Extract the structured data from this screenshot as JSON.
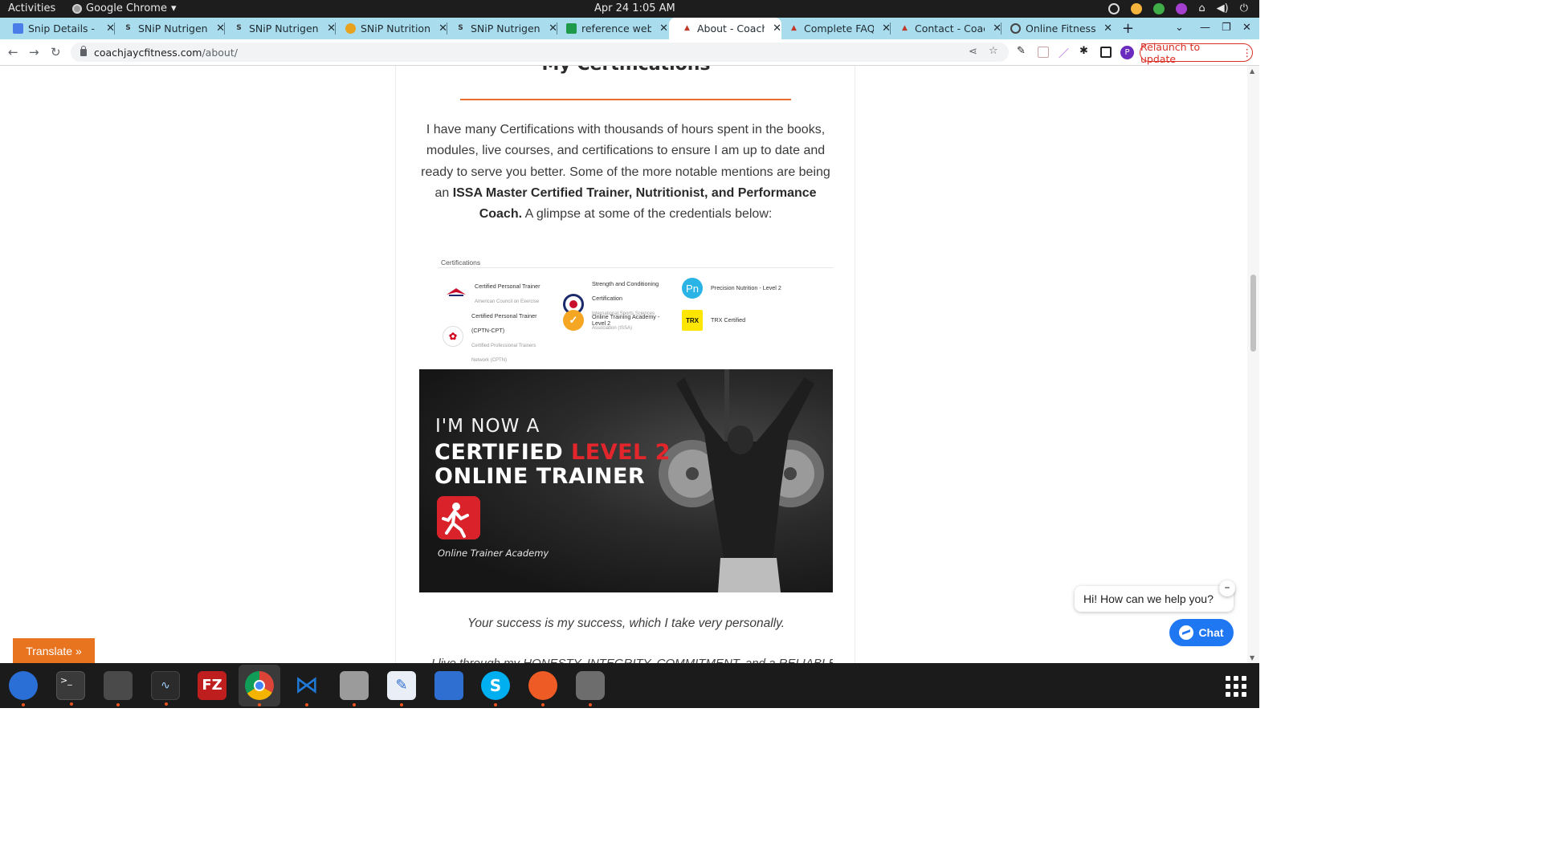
{
  "system_bar": {
    "activities": "Activities",
    "app_name": "Google Chrome",
    "clock": "Apr 24  1:05 AM"
  },
  "tabs": [
    {
      "title": "Snip Details - Google Docs",
      "icon": "docs-icon"
    },
    {
      "title": "SNiP Nutrigenomics",
      "icon": "snip-icon"
    },
    {
      "title": "SNiP Nutrigenomics",
      "icon": "snip-icon"
    },
    {
      "title": "SNiP Nutrition",
      "icon": "snip-nutrition-icon"
    },
    {
      "title": "SNiP Nutrigenomics",
      "icon": "snip-icon"
    },
    {
      "title": "reference websites",
      "icon": "sheets-icon"
    },
    {
      "title": "About - Coach Jay C Fitness",
      "icon": "coach-icon",
      "active": true
    },
    {
      "title": "Complete FAQs",
      "icon": "coach-icon"
    },
    {
      "title": "Contact - Coach Jay",
      "icon": "coach-icon"
    },
    {
      "title": "Online Fitness",
      "icon": "globe-icon"
    }
  ],
  "address_bar": {
    "domain": "coachjaycfitness.com",
    "path": "/about/",
    "relaunch_label": "Relaunch to update",
    "avatar_letter": "P"
  },
  "page": {
    "partial_heading": "My Certifications",
    "paragraph_pre": "I have many Certifications with thousands of hours spent in the books, modules, live courses, and certifications to ensure I am up to date and ready to serve you better. Some of the more notable mentions are being an ",
    "paragraph_bold": "ISSA Master Certified Trainer, Nutritionist, and Performance Coach.",
    "paragraph_post": " A glimpse at some of the credentials below:",
    "cert_heading": "Certifications",
    "certs": [
      {
        "name": "Certified Personal Trainer",
        "issuer": "American Council on Exercise",
        "logo": "ace-logo",
        "color": "#c8102e"
      },
      {
        "name": "Strength and Conditioning Certification",
        "issuer": "International Sports Sciences Association (ISSA)",
        "logo": "issa-logo",
        "color": "#1b2a6b"
      },
      {
        "name": "Precision Nutrition - Level 2",
        "issuer": "",
        "logo": "pn-logo",
        "color": "#2ab4e6"
      },
      {
        "name": "Certified Personal Trainer (CPTN-CPT)",
        "issuer": "Certified Professional Trainers Network (CPTN)",
        "logo": "cptn-logo",
        "color": "#d0021b"
      },
      {
        "name": "Online Training Academy - Level 2",
        "issuer": "",
        "logo": "ota-logo",
        "color": "#f5a623"
      },
      {
        "name": "TRX Certified",
        "issuer": "",
        "logo": "trx-logo",
        "color": "#ffe600"
      }
    ],
    "promo": {
      "line1": "I'M NOW A",
      "line2_a": "CERTIFIED ",
      "line2_b": "LEVEL 2",
      "line3": "ONLINE TRAINER",
      "caption": "Online Trainer Academy"
    },
    "quote": "Your success is my success, which I take very personally.",
    "cutoff_line": "I live through my HONESTY, INTEGRITY, COMMITMENT, and a RELIABLE"
  },
  "widgets": {
    "translate": "Translate »",
    "chat_prompt": "Hi! How can we help you?",
    "chat_button": "Chat"
  },
  "dock": [
    {
      "name": "thunderbird-icon",
      "color": "#2a6fd6"
    },
    {
      "name": "terminal-icon",
      "color": "#3a3a3a"
    },
    {
      "name": "calculator-icon",
      "color": "#4a4a4a"
    },
    {
      "name": "system-monitor-icon",
      "color": "#2b2b2b"
    },
    {
      "name": "filezilla-icon",
      "color": "#bf1e1e"
    },
    {
      "name": "chrome-icon",
      "color": "#ffffff"
    },
    {
      "name": "vscode-icon",
      "color": "#1e7ad6"
    },
    {
      "name": "files-icon",
      "color": "#9b9b9b"
    },
    {
      "name": "text-editor-icon",
      "color": "#e9eef7"
    },
    {
      "name": "libreoffice-writer-icon",
      "color": "#2f6fd1"
    },
    {
      "name": "skype-icon",
      "color": "#00aff0"
    },
    {
      "name": "postman-icon",
      "color": "#ef5b25"
    },
    {
      "name": "disk-icon",
      "color": "#6d6d6d"
    }
  ]
}
